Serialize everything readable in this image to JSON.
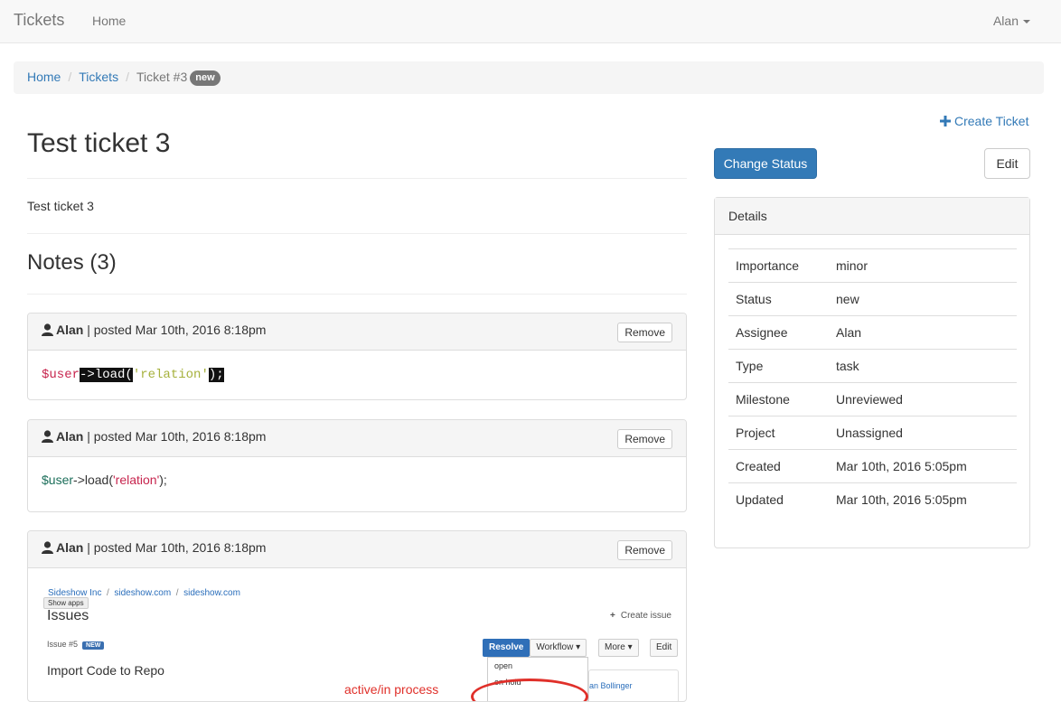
{
  "navbar": {
    "brand": "Tickets",
    "home": "Home",
    "user": "Alan"
  },
  "breadcrumb": {
    "home": "Home",
    "tickets": "Tickets",
    "current": "Ticket #3",
    "badge": "new"
  },
  "ticket": {
    "title": "Test ticket 3",
    "description": "Test ticket 3"
  },
  "notes": {
    "heading": "Notes (3)",
    "remove_label": "Remove",
    "items": [
      {
        "author": "Alan",
        "meta": "| posted Mar 10th, 2016 8:18pm",
        "code": {
          "var": "$user",
          "arrow": "->load(",
          "str": "'relation'",
          "end": ");"
        }
      },
      {
        "author": "Alan",
        "meta": "| posted Mar 10th, 2016 8:18pm",
        "code": {
          "var": "$user",
          "arrow": "->load(",
          "str": "'relation'",
          "end": ");"
        }
      },
      {
        "author": "Alan",
        "meta": "| posted Mar 10th, 2016 8:18pm"
      }
    ]
  },
  "embedded_screenshot": {
    "crumb_1": "Sideshow Inc",
    "sep": "/",
    "crumb_2": "sideshow.com",
    "crumb_3": "sideshow.com",
    "show_apps": "Show apps",
    "issues": "Issues",
    "create_issue": "Create issue",
    "issue_number": "Issue #5",
    "issue_badge": "NEW",
    "resolve": "Resolve",
    "workflow": "Workflow",
    "more": "More",
    "edit": "Edit",
    "import_title": "Import Code to Repo",
    "dropdown_open": "open",
    "dropdown_hold": "on hold",
    "assignee": "an Bollinger",
    "annotation": "active/in process"
  },
  "sidebar": {
    "create_ticket": "Create Ticket",
    "change_status": "Change Status",
    "edit": "Edit",
    "details_heading": "Details",
    "details": [
      {
        "key": "Importance",
        "value": "minor"
      },
      {
        "key": "Status",
        "value": "new"
      },
      {
        "key": "Assignee",
        "value": "Alan"
      },
      {
        "key": "Type",
        "value": "task"
      },
      {
        "key": "Milestone",
        "value": "Unreviewed"
      },
      {
        "key": "Project",
        "value": "Unassigned"
      },
      {
        "key": "Created",
        "value": "Mar 10th, 2016 5:05pm"
      },
      {
        "key": "Updated",
        "value": "Mar 10th, 2016 5:05pm"
      }
    ]
  },
  "colors": {
    "link": "#337ab7",
    "primary": "#337ab7",
    "badge": "#777777",
    "annotation": "#e0302a"
  }
}
